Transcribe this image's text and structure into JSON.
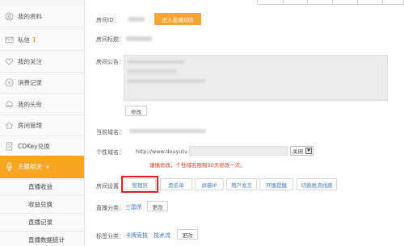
{
  "sidebar": {
    "items": [
      {
        "label": "我的资料",
        "icon": "user-circle-icon"
      },
      {
        "label": "私信",
        "badge": "1",
        "icon": "mail-icon"
      },
      {
        "label": "我的关注",
        "icon": "heart-icon"
      },
      {
        "label": "消费记录",
        "icon": "coin-icon"
      },
      {
        "label": "我的头衔",
        "icon": "helmet-icon"
      },
      {
        "label": "房间管理",
        "icon": "home-icon"
      },
      {
        "label": "CDKey兑换",
        "icon": "card-icon"
      }
    ],
    "active_item": {
      "label": "主播相关",
      "icon": "mic-icon",
      "caret": "∨"
    },
    "sub_items": [
      "直播收益",
      "收益兑换",
      "直播记录",
      "直播数据统计"
    ]
  },
  "main": {
    "room_id_label": "房间ID：",
    "enter_room_button": "进入直播间间",
    "room_title_label": "房间标题：",
    "room_notice_label": "房间公告：",
    "modify_button": "修改",
    "current_domain_label": "当前域名：",
    "custom_domain_label": "个性域名：",
    "custom_domain_prefix": "http://www.douyutv.com/",
    "domain_toggle": "关闭",
    "warning": "谨慎修改，个性域名限制30天修改一次。",
    "room_settings_label": "房间设置",
    "settings_buttons": [
      "管理员",
      "黑名单",
      "屏蔽IP",
      "用户发言",
      "开播提醒",
      "切换推流线路"
    ],
    "live_category_label": "直播分类：",
    "live_category_value": "三国杀",
    "change_button": "更改",
    "tag_category_label": "标签分类：",
    "tags": [
      "卡牌竞技",
      "技术流"
    ],
    "tag_change_button": "更改"
  },
  "colors": {
    "accent": "#f6a623",
    "warning": "#e23b1e",
    "link": "#3a76c4",
    "highlight_box": "#dd2222"
  }
}
